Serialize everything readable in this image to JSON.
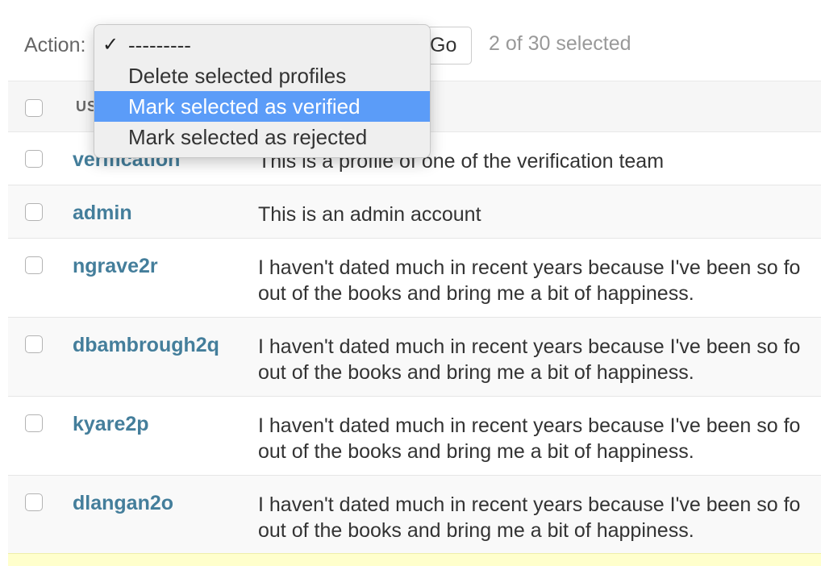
{
  "actions": {
    "label": "Action:",
    "go_label": "Go",
    "selected_count": "2 of 30 selected",
    "dropdown": {
      "checkmark": "✓",
      "options": [
        "---------",
        "Delete selected profiles",
        "Mark selected as verified",
        "Mark selected as rejected"
      ],
      "selected_index": 0,
      "highlighted_index": 2
    }
  },
  "table": {
    "header_visible_text": "US",
    "rows": [
      {
        "username": "verification",
        "bio": [
          "This is a profile of one of the verification team"
        ]
      },
      {
        "username": "admin",
        "bio": [
          "This is an admin account"
        ]
      },
      {
        "username": "ngrave2r",
        "bio": [
          "I haven't dated much in recent years because I've been so fo",
          "out of the books and bring me a bit of happiness."
        ]
      },
      {
        "username": "dbambrough2q",
        "bio": [
          "I haven't dated much in recent years because I've been so fo",
          "out of the books and bring me a bit of happiness."
        ]
      },
      {
        "username": "kyare2p",
        "bio": [
          "I haven't dated much in recent years because I've been so fo",
          "out of the books and bring me a bit of happiness."
        ]
      },
      {
        "username": "dlangan2o",
        "bio": [
          "I haven't dated much in recent years because I've been so fo",
          "out of the books and bring me a bit of happiness."
        ]
      }
    ]
  },
  "colors": {
    "link": "#447e9b",
    "highlight": "#5b9cf8",
    "selected_row": "#ffffcc"
  }
}
